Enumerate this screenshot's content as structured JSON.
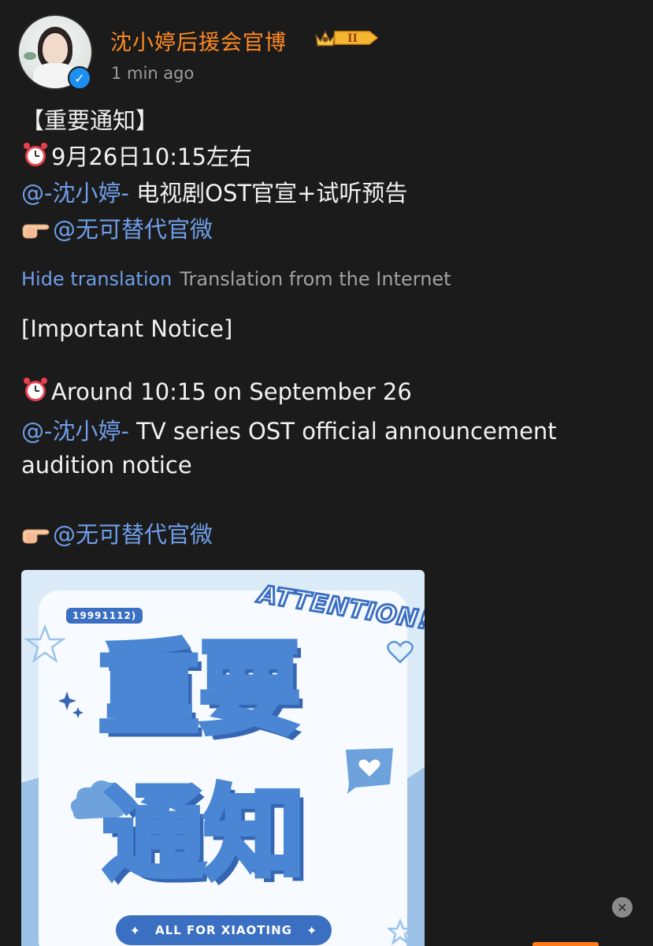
{
  "author": {
    "name": "沈小婷后援会官博",
    "vip_level": "II",
    "timestamp": "1 min ago"
  },
  "post": {
    "title": "【重要通知】",
    "time_line": "9月26日10:15左右",
    "mention_1": "@-沈小婷-",
    "mention_1_text": " 电视剧OST官宣+试听预告",
    "mention_2": "@无可替代官微"
  },
  "translation": {
    "hide_label": "Hide translation",
    "source_label": "Translation from the Internet",
    "title": "[Important Notice]",
    "time_line": "Around 10:15 on September 26",
    "mention_1": "@-沈小婷-",
    "mention_1_text": " TV series OST official announcement",
    "mention_1_text_cont": "audition notice",
    "mention_2": "@无可替代官微"
  },
  "image": {
    "id_tag": "19991112)",
    "attention": "ATTENTION!",
    "line1": "重要",
    "line2": "通知",
    "banner": "ALL FOR XIAOTING"
  },
  "icons": {
    "alarm": "alarm-clock-icon",
    "pointing": "pointing-hand-icon",
    "verified": "verified-icon",
    "close": "close-icon"
  },
  "colors": {
    "username": "#ff8a23",
    "mention": "#6f9ee8",
    "background": "#1b1b1b",
    "card_blue": "#4a86d4"
  }
}
